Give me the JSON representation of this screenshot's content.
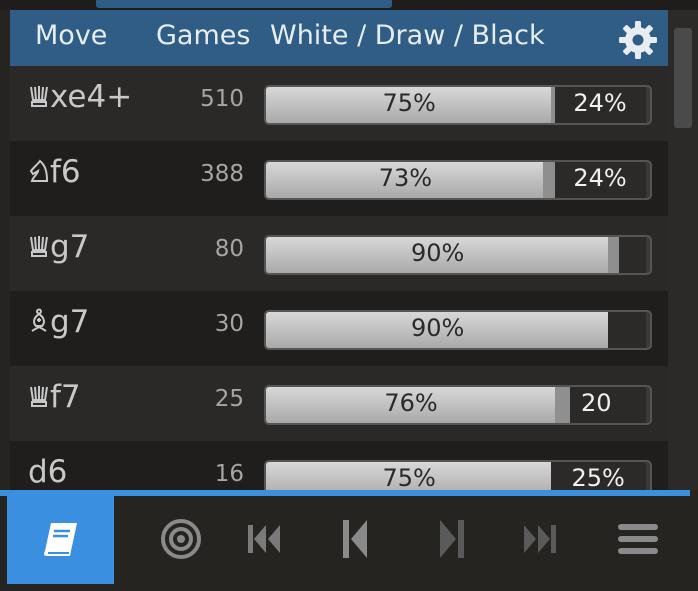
{
  "header": {
    "move_label": "Move",
    "games_label": "Games",
    "wdb_label": "White / Draw / Black"
  },
  "rows": [
    {
      "piece": "queen",
      "move": "xe4+",
      "games": "510",
      "white": 75,
      "draw": 1,
      "black": 24,
      "white_label": "75%",
      "black_label": "24%"
    },
    {
      "piece": "knight",
      "move": "f6",
      "games": "388",
      "white": 73,
      "draw": 3,
      "black": 24,
      "white_label": "73%",
      "black_label": "24%"
    },
    {
      "piece": "queen",
      "move": "g7",
      "games": "80",
      "white": 90,
      "draw": 3,
      "black": 7,
      "white_label": "90%",
      "black_label": ""
    },
    {
      "piece": "bishop",
      "move": "g7",
      "games": "30",
      "white": 90,
      "draw": 0,
      "black": 10,
      "white_label": "90%",
      "black_label": ""
    },
    {
      "piece": "queen",
      "move": "f7",
      "games": "25",
      "white": 76,
      "draw": 4,
      "black": 20,
      "white_label": "76%",
      "black_label": "20"
    },
    {
      "piece": "",
      "move": "d6",
      "games": "16",
      "white": 75,
      "draw": 0,
      "black": 25,
      "white_label": "75%",
      "black_label": "25%"
    }
  ],
  "footer": {
    "buttons": [
      {
        "name": "book-icon",
        "active": true
      },
      {
        "name": "target-icon",
        "active": false
      },
      {
        "name": "first-move-icon",
        "active": false
      },
      {
        "name": "prev-move-icon",
        "active": false
      },
      {
        "name": "next-move-icon",
        "active": false
      },
      {
        "name": "last-move-icon",
        "active": false
      },
      {
        "name": "menu-icon",
        "active": false
      }
    ]
  }
}
